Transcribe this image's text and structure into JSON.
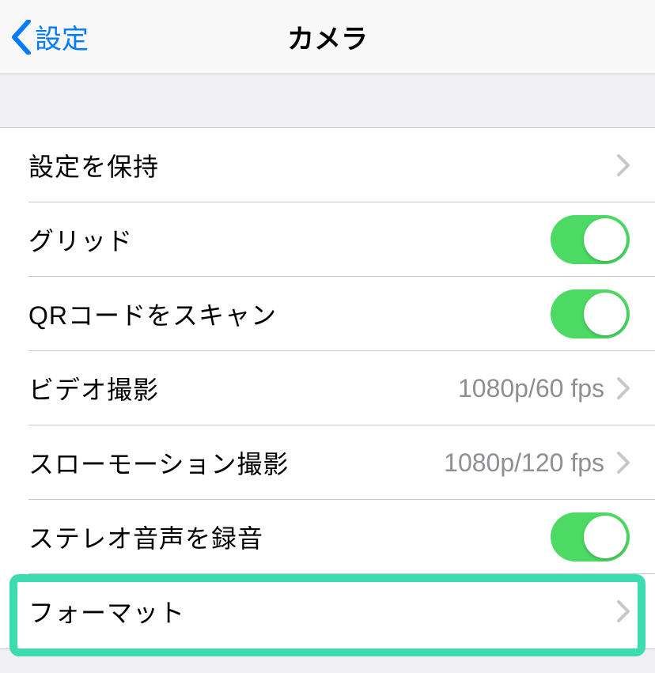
{
  "navbar": {
    "back_label": "設定",
    "title": "カメラ"
  },
  "rows": {
    "preserve": {
      "label": "設定を保持"
    },
    "grid": {
      "label": "グリッド"
    },
    "qr": {
      "label": "QRコードをスキャン"
    },
    "video": {
      "label": "ビデオ撮影",
      "value": "1080p/60 fps"
    },
    "slomo": {
      "label": "スローモーション撮影",
      "value": "1080p/120 fps"
    },
    "stereo": {
      "label": "ステレオ音声を録音"
    },
    "format": {
      "label": "フォーマット"
    }
  },
  "toggles": {
    "grid": true,
    "qr": true,
    "stereo": true
  }
}
